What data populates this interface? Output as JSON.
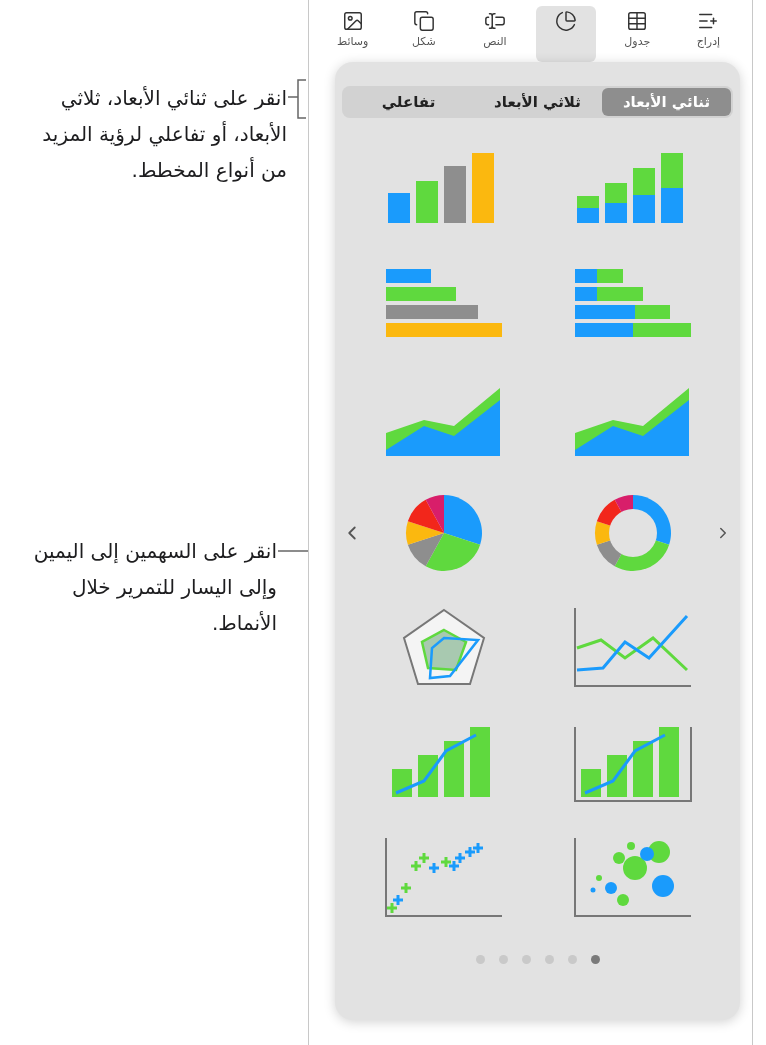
{
  "callouts": [
    {
      "text": "انقر على ثنائي الأبعاد، ثلاثي الأبعاد، أو تفاعلي لرؤية المزيد من أنواع المخطط.",
      "kind": "bracket"
    },
    {
      "text": "انقر على السهمين إلى اليمين وإلى اليسار للتمرير خلال الأنماط.",
      "kind": "line"
    }
  ],
  "toolbar": [
    {
      "kind": "insert",
      "label": "إدراج",
      "selected": false
    },
    {
      "kind": "table",
      "label": "جدول",
      "selected": false
    },
    {
      "kind": "chart",
      "selected": true
    },
    {
      "kind": "text",
      "label": "النص",
      "selected": false
    },
    {
      "kind": "shape",
      "label": "شكل",
      "selected": false
    },
    {
      "kind": "media",
      "label": "وسائط",
      "selected": false
    }
  ],
  "tabs": [
    {
      "label": "ثنائي الأبعاد",
      "selected": true
    },
    {
      "label": "ثلاثي الأبعاد",
      "selected": false
    },
    {
      "label": "تفاعلي",
      "selected": false
    }
  ],
  "chart_styles": [
    {
      "kind": "stacked-column"
    },
    {
      "kind": "column"
    },
    {
      "kind": "stacked-bar"
    },
    {
      "kind": "bar"
    },
    {
      "kind": "stacked-area"
    },
    {
      "kind": "area"
    },
    {
      "kind": "donut"
    },
    {
      "kind": "pie"
    },
    {
      "kind": "line"
    },
    {
      "kind": "radar"
    },
    {
      "kind": "column-line-axes"
    },
    {
      "kind": "column-line"
    },
    {
      "kind": "bubble"
    },
    {
      "kind": "scatter"
    }
  ],
  "pages": [
    {
      "selected": true
    },
    {
      "selected": false
    },
    {
      "selected": false
    },
    {
      "selected": false
    },
    {
      "selected": false
    },
    {
      "selected": false
    }
  ]
}
